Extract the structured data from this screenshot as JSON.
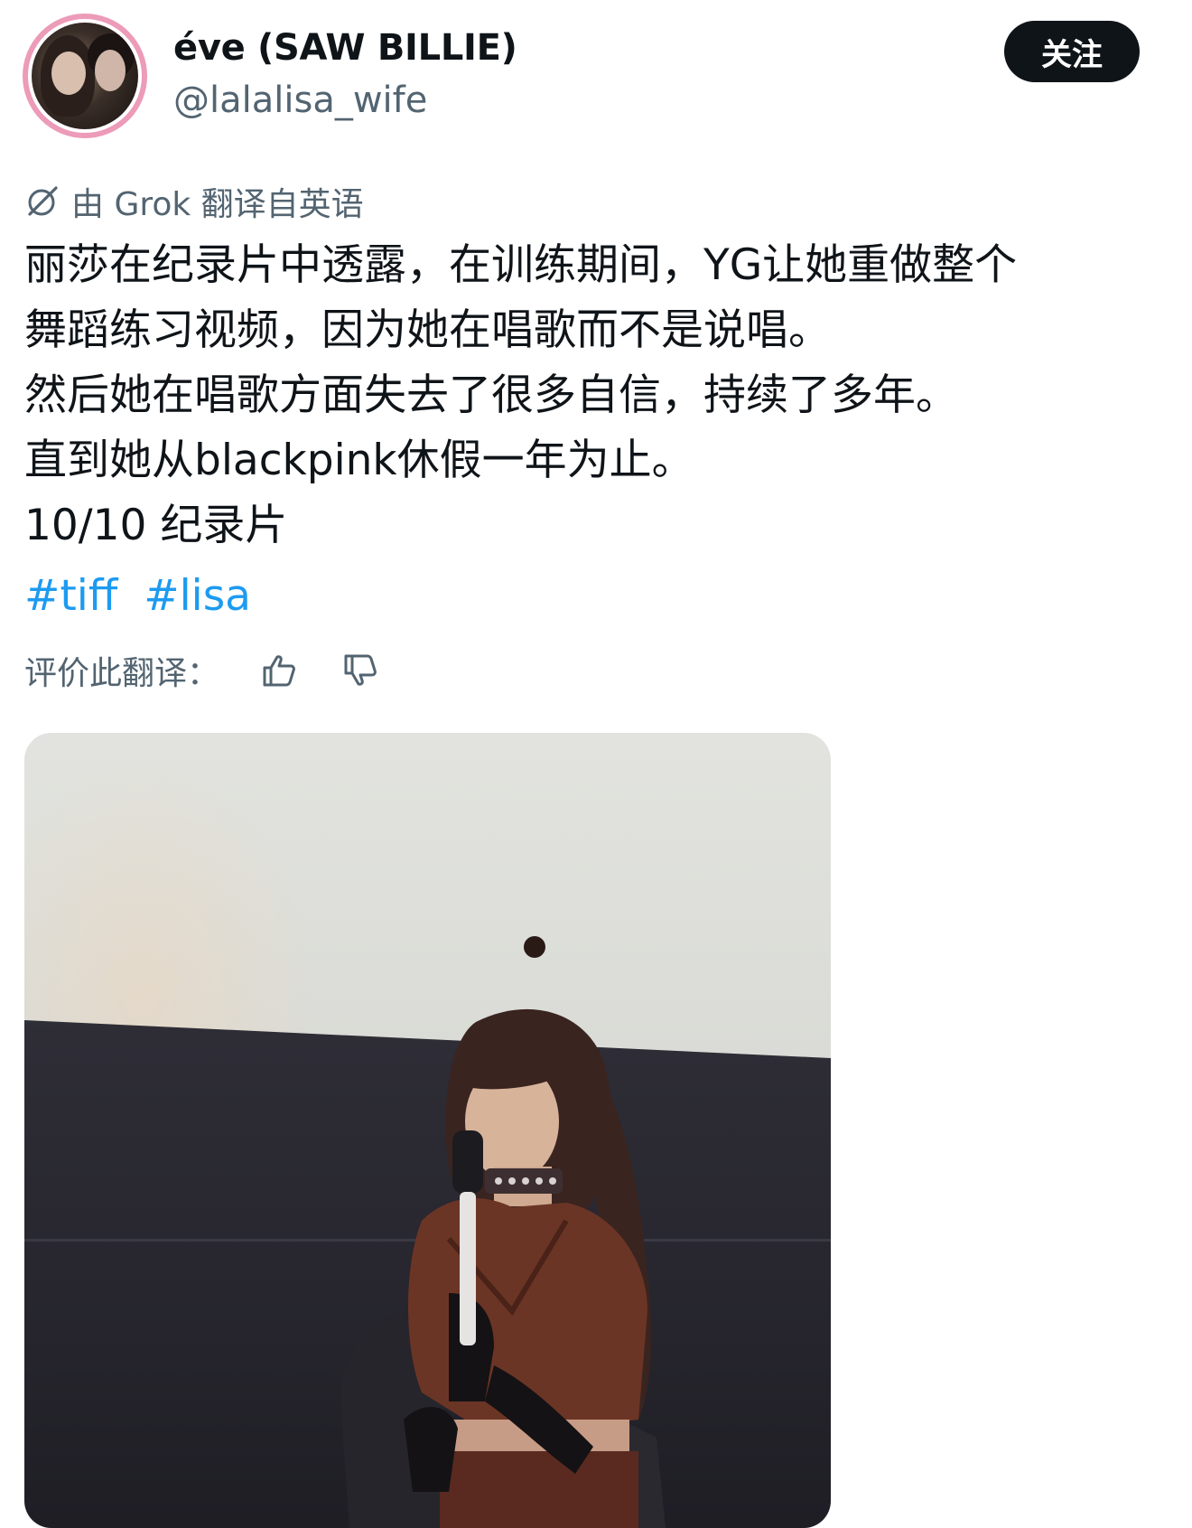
{
  "user": {
    "display_name": "éve (SAW BILLIE)",
    "handle": "@lalalisa_wife"
  },
  "follow_button": {
    "label": "关注"
  },
  "translation": {
    "note": "由 Grok 翻译自英语",
    "icon": "grok-icon"
  },
  "tweet": {
    "lines": [
      "丽莎在纪录片中透露，在训练期间，YG让她重做整个",
      "舞蹈练习视频，因为她在唱歌而不是说唱。",
      "然后她在唱歌方面失去了很多自信，持续了多年。",
      "直到她从blackpink休假一年为止。",
      "10/10 纪录片"
    ],
    "hashtags": [
      "#tiff",
      "#lisa"
    ]
  },
  "rating": {
    "label": "评价此翻译：",
    "thumbs_up_icon": "thumbs-up-icon",
    "thumbs_down_icon": "thumbs-down-icon"
  },
  "colors": {
    "text": "#0f1419",
    "secondary": "#536471",
    "link": "#1d9bf0",
    "button_bg": "#0f1419",
    "avatar_ring": "#ec9bb8"
  }
}
